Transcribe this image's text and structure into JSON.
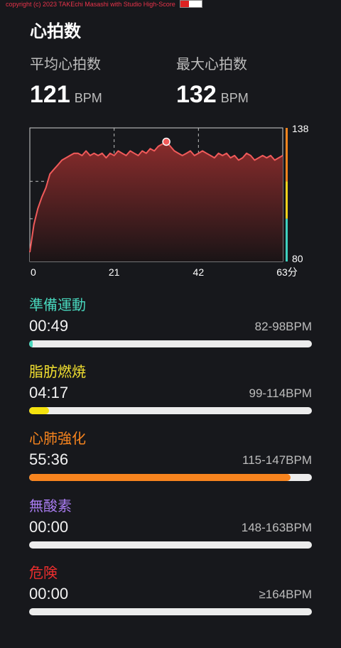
{
  "copyright": "copyright (c) 2023 TAKEchi Masashi with Studio High-Score",
  "title": "心拍数",
  "stats": {
    "avg_label": "平均心拍数",
    "avg_value": "121",
    "avg_unit": "BPM",
    "max_label": "最大心拍数",
    "max_value": "132",
    "max_unit": "BPM"
  },
  "chart_data": {
    "type": "area",
    "xlabel": "",
    "ylabel": "",
    "x_ticks": [
      "0",
      "21",
      "42",
      "63分"
    ],
    "y_ticks": [
      "138",
      "80"
    ],
    "ylim": [
      80,
      138
    ],
    "xlim": [
      0,
      63
    ],
    "max_marker": {
      "x": 34,
      "y": 132
    },
    "series": [
      {
        "x": [
          0,
          1,
          2,
          3,
          4,
          5,
          6,
          7,
          8,
          9,
          10,
          11,
          12,
          13,
          14,
          15,
          16,
          17,
          18,
          19,
          20,
          21,
          22,
          23,
          24,
          25,
          26,
          27,
          28,
          29,
          30,
          31,
          32,
          33,
          34,
          35,
          36,
          37,
          38,
          39,
          40,
          41,
          42,
          43,
          44,
          45,
          46,
          47,
          48,
          49,
          50,
          51,
          52,
          53,
          54,
          55,
          56,
          57,
          58,
          59,
          60,
          61,
          62,
          63
        ],
        "y": [
          84,
          96,
          103,
          108,
          112,
          118,
          120,
          122,
          124,
          125,
          126,
          127,
          127,
          126,
          128,
          126,
          127,
          126,
          127,
          125,
          127,
          126,
          128,
          127,
          126,
          128,
          127,
          126,
          128,
          127,
          129,
          128,
          130,
          131,
          132,
          130,
          128,
          127,
          126,
          127,
          128,
          126,
          127,
          128,
          127,
          126,
          125,
          127,
          126,
          127,
          125,
          126,
          124,
          125,
          127,
          126,
          124,
          125,
          126,
          125,
          126,
          124,
          125,
          126
        ]
      }
    ],
    "grid": true,
    "zone_colors": [
      "#f7841e",
      "#f5d21c",
      "#3fd1c0"
    ]
  },
  "zones": [
    {
      "name": "準備運動",
      "color": "#48d7bd",
      "time": "00:49",
      "range": "82-98BPM",
      "fill": 0.013
    },
    {
      "name": "脂肪燃焼",
      "color": "#f2e030",
      "time": "04:17",
      "range": "99-114BPM",
      "fill": 0.07
    },
    {
      "name": "心肺強化",
      "color": "#f7841e",
      "time": "55:36",
      "range": "115-147BPM",
      "fill": 0.925
    },
    {
      "name": "無酸素",
      "color": "#a97cf1",
      "time": "00:00",
      "range": "148-163BPM",
      "fill": 0
    },
    {
      "name": "危険",
      "color": "#ee2e2e",
      "time": "00:00",
      "range": "≥164BPM",
      "fill": 0
    }
  ]
}
